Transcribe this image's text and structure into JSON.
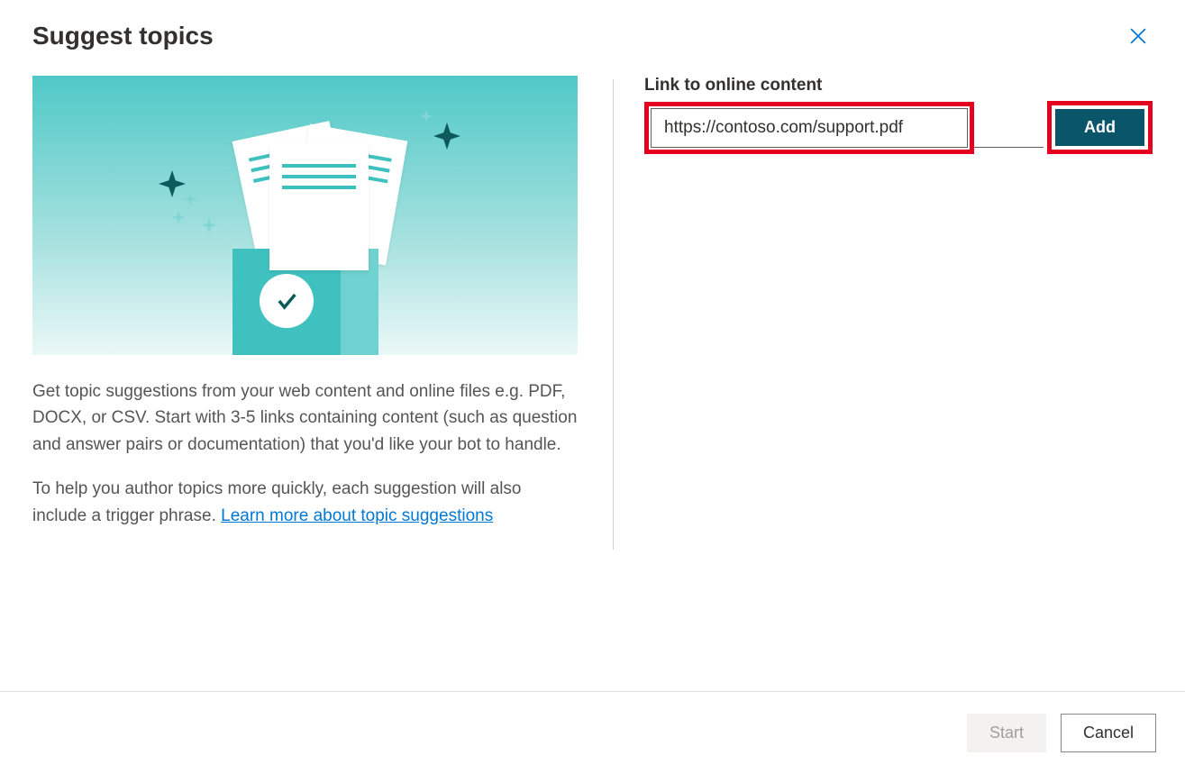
{
  "header": {
    "title": "Suggest topics"
  },
  "left": {
    "description_p1": "Get topic suggestions from your web content and online files e.g. PDF, DOCX, or CSV. Start with 3-5 links containing content (such as question and answer pairs or documentation) that you'd like your bot to handle.",
    "description_p2": "To help you author topics more quickly, each suggestion will also include a trigger phrase. ",
    "learn_more": "Learn more about topic suggestions"
  },
  "right": {
    "label": "Link to online content",
    "url_value": "https://contoso.com/support.pdf",
    "add_button": "Add"
  },
  "footer": {
    "start": "Start",
    "cancel": "Cancel"
  }
}
